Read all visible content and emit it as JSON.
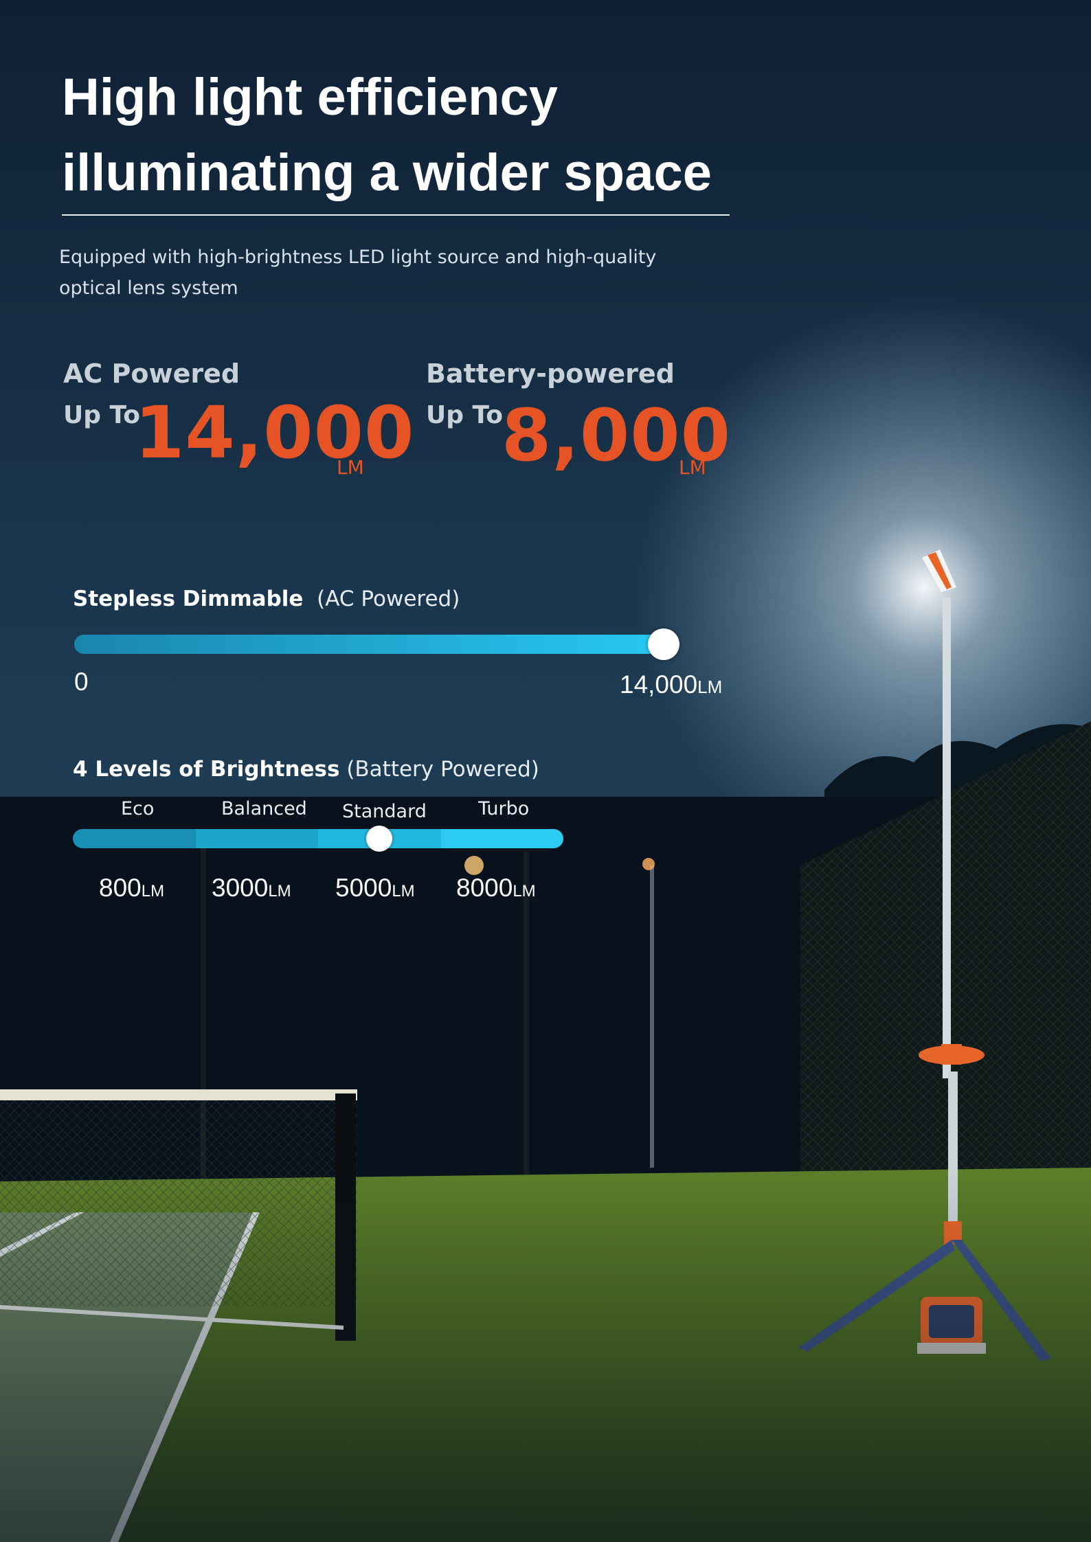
{
  "headline": {
    "line1": "High light efficiency",
    "line2": "illuminating a wider space"
  },
  "subtitle": {
    "line1": "Equipped with high-brightness LED light source and high-quality",
    "line2": "optical lens system"
  },
  "specs": [
    {
      "label": "AC Powered",
      "prefix": "Up To",
      "value": "14,000",
      "unit": "LM"
    },
    {
      "label": "Battery-powered",
      "prefix": "Up To",
      "value": "8,000",
      "unit": "LM"
    }
  ],
  "stepless": {
    "title": "Stepless Dimmable",
    "note": "(AC Powered)",
    "min_label": "0",
    "max_value": "14,000",
    "max_unit": "LM",
    "position": 1.0
  },
  "levels": {
    "title": "4 Levels of Brightness",
    "note": "(Battery Powered)",
    "selected_index": 2,
    "items": [
      {
        "name": "Eco",
        "value": "800",
        "unit": "LM",
        "color": "#1a8fb5"
      },
      {
        "name": "Balanced",
        "value": "3000",
        "unit": "LM",
        "color": "#1ea5cc"
      },
      {
        "name": "Standard",
        "value": "5000",
        "unit": "LM",
        "color": "#22b8e0"
      },
      {
        "name": "Turbo",
        "value": "8000",
        "unit": "LM",
        "color": "#2ccbf3"
      }
    ]
  },
  "colors": {
    "accent": "#e65325",
    "slider_start": "#1a86ae",
    "slider_end": "#27c8f2",
    "sky_top": "#0f2236",
    "turf": "#4e6b24",
    "tripod": "#3b5185",
    "light_body": "#e8652a"
  }
}
